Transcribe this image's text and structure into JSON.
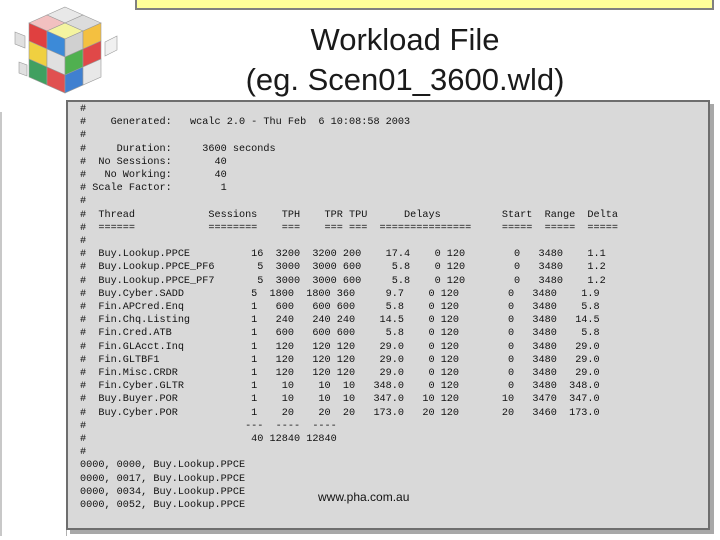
{
  "slide": {
    "title_line1": "Workload File",
    "title_line2": "(eg. Scen01_3600.wld)",
    "url": "www.pha.com.au"
  },
  "logo": {
    "icon": "colored-cube-logo-icon"
  },
  "file_lines": [
    "#",
    "#    Generated:   wcalc 2.0 - Thu Feb  6 10:08:58 2003",
    "#",
    "#     Duration:     3600 seconds",
    "#  No Sessions:       40",
    "#   No Working:       40",
    "# Scale Factor:        1",
    "#",
    "#  Thread            Sessions    TPH    TPR TPU      Delays          Start  Range  Delta",
    "#  ======            ========    ===    === ===  ===============     =====  =====  =====",
    "#",
    "#  Buy.Lookup.PPCE          16  3200  3200 200    17.4    0 120        0   3480    1.1",
    "#  Buy.Lookup.PPCE_PF6       5  3000  3000 600     5.8    0 120        0   3480    1.2",
    "#  Buy.Lookup.PPCE_PF7       5  3000  3000 600     5.8    0 120        0   3480    1.2",
    "#  Buy.Cyber.SADD           5  1800  1800 360     9.7    0 120        0   3480    1.9",
    "#  Fin.APCred.Enq           1   600   600 600     5.8    0 120        0   3480    5.8",
    "#  Fin.Chq.Listing          1   240   240 240    14.5    0 120        0   3480   14.5",
    "#  Fin.Cred.ATB             1   600   600 600     5.8    0 120        0   3480    5.8",
    "#  Fin.GLAcct.Inq           1   120   120 120    29.0    0 120        0   3480   29.0",
    "#  Fin.GLTBF1               1   120   120 120    29.0    0 120        0   3480   29.0",
    "#  Fin.Misc.CRDR            1   120   120 120    29.0    0 120        0   3480   29.0",
    "#  Fin.Cyber.GLTR           1    10    10  10   348.0    0 120        0   3480  348.0",
    "#  Buy.Buyer.POR            1    10    10  10   347.0   10 120       10   3470  347.0",
    "#  Buy.Cyber.POR            1    20    20  20   173.0   20 120       20   3460  173.0",
    "#                          ---  ----  ----",
    "#                           40 12840 12840",
    "#",
    "0000, 0000, Buy.Lookup.PPCE",
    "0000, 0017, Buy.Lookup.PPCE",
    "0000, 0034, Buy.Lookup.PPCE",
    "0000, 0052, Buy.Lookup.PPCE"
  ]
}
